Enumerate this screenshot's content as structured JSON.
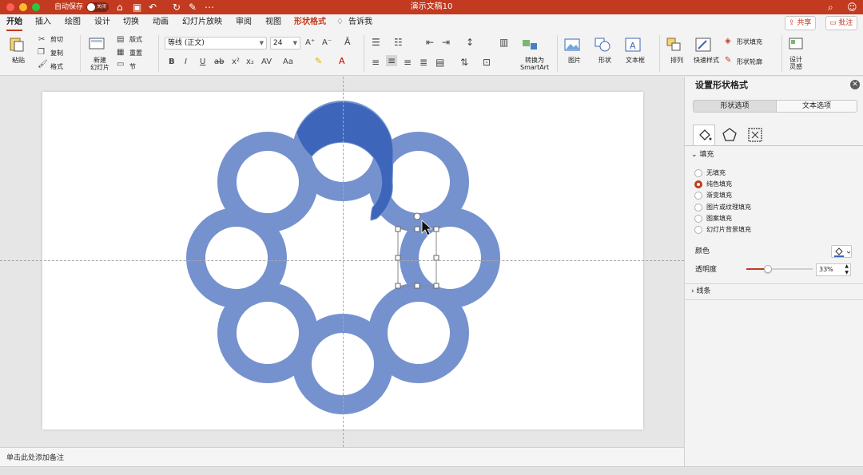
{
  "titlebar": {
    "autosave_label": "自动保存",
    "autosave_state": "关闭",
    "doc_title": "演示文稿10"
  },
  "tabs": [
    {
      "label": "开始",
      "active": true
    },
    {
      "label": "插入"
    },
    {
      "label": "绘图"
    },
    {
      "label": "设计"
    },
    {
      "label": "切换"
    },
    {
      "label": "动画"
    },
    {
      "label": "幻灯片放映"
    },
    {
      "label": "审阅"
    },
    {
      "label": "视图"
    },
    {
      "label": "形状格式"
    },
    {
      "label": "告诉我"
    }
  ],
  "top_buttons": {
    "share": "共享",
    "comment": "批注"
  },
  "ribbon": {
    "paste": "粘贴",
    "cut": "剪切",
    "copy": "复制",
    "format_painter": "格式",
    "new_slide": "新建\n幻灯片",
    "layout": "版式",
    "reset": "重置",
    "section": "节",
    "font_name": "等线 (正文)",
    "font_size": "24",
    "convert_smartart": "转换为\nSmartArt",
    "picture": "图片",
    "shape": "形状",
    "textbox": "文本框",
    "arrange": "排列",
    "quick_styles": "快速样式",
    "shape_fill": "形状填充",
    "shape_outline": "形状轮廓",
    "designer": "设计\n灵感"
  },
  "canvas": {
    "ring_color": "#7592cf",
    "highlight_color": "#3d66bb"
  },
  "notes": {
    "placeholder": "单击此处添加备注"
  },
  "panel": {
    "title": "设置形状格式",
    "tab_shape": "形状选项",
    "tab_text": "文本选项",
    "fill_section": "填充",
    "fill_options": [
      "无填充",
      "纯色填充",
      "渐变填充",
      "图片或纹理填充",
      "图案填充",
      "幻灯片背景填充"
    ],
    "fill_selected": 1,
    "color_label": "颜色",
    "transparency_label": "透明度",
    "transparency_value": "33%",
    "transparency": 0.33,
    "line_section": "线条"
  }
}
